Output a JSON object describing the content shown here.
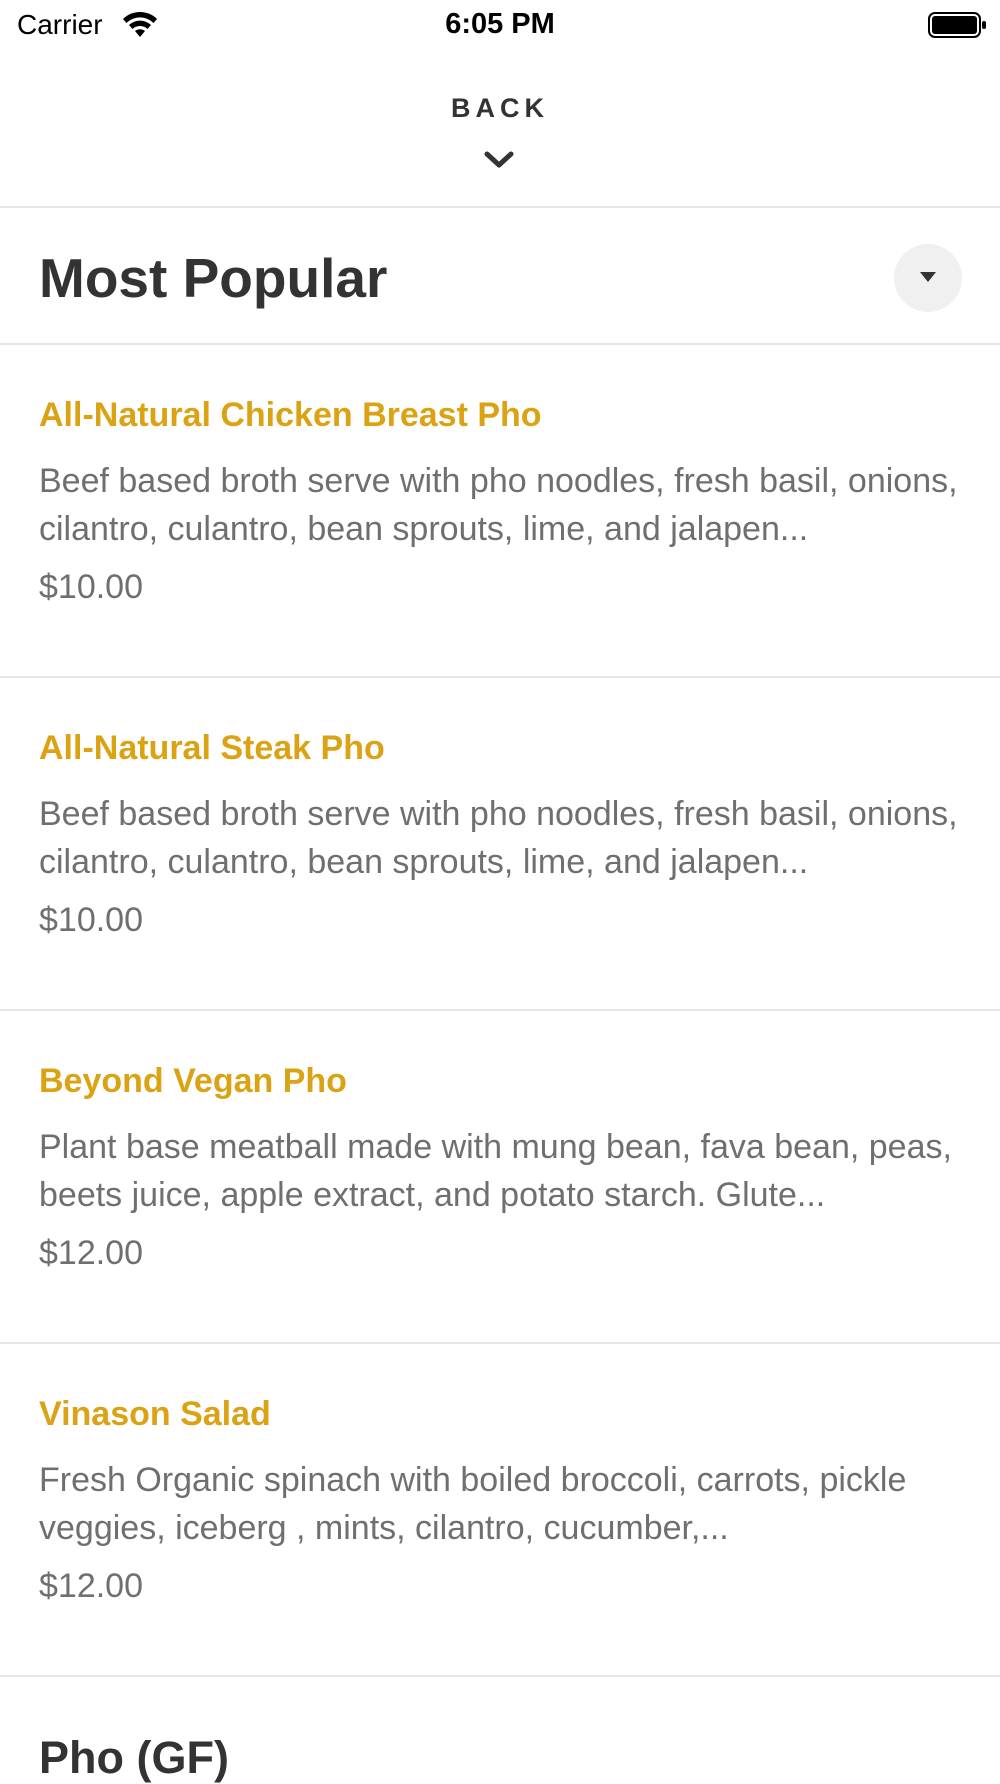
{
  "status_bar": {
    "carrier": "Carrier",
    "time": "6:05 PM",
    "wifi_icon": "wifi-icon",
    "battery_icon": "battery-icon"
  },
  "header": {
    "back_label": "BACK",
    "chevron_icon": "chevron-down-icon"
  },
  "section": {
    "title": "Most Popular",
    "toggle_icon": "caret-down-icon"
  },
  "menu_items": [
    {
      "name": "All-Natural Chicken Breast Pho",
      "description": "Beef based broth serve with pho noodles, fresh basil, onions, cilantro, culantro, bean sprouts, lime, and jalapen...",
      "price": "$10.00"
    },
    {
      "name": "All-Natural Steak Pho",
      "description": "Beef based broth serve with pho noodles, fresh basil, onions, cilantro, culantro, bean sprouts, lime, and jalapen...",
      "price": "$10.00"
    },
    {
      "name": "Beyond Vegan Pho",
      "description": "Plant base meatball made with mung bean, fava bean, peas, beets juice, apple extract, and potato starch.  Glute...",
      "price": "$12.00"
    },
    {
      "name": "Vinason Salad",
      "description": "Fresh Organic spinach with boiled broccoli, carrots, pickle veggies, iceberg , mints, cilantro, cucumber,...",
      "price": "$12.00"
    }
  ],
  "next_section": {
    "title": "Pho (GF)"
  },
  "colors": {
    "item_name": "#dba313",
    "body_text": "#6f6f6f",
    "heading": "#333333",
    "divider": "#e6e6e6"
  }
}
